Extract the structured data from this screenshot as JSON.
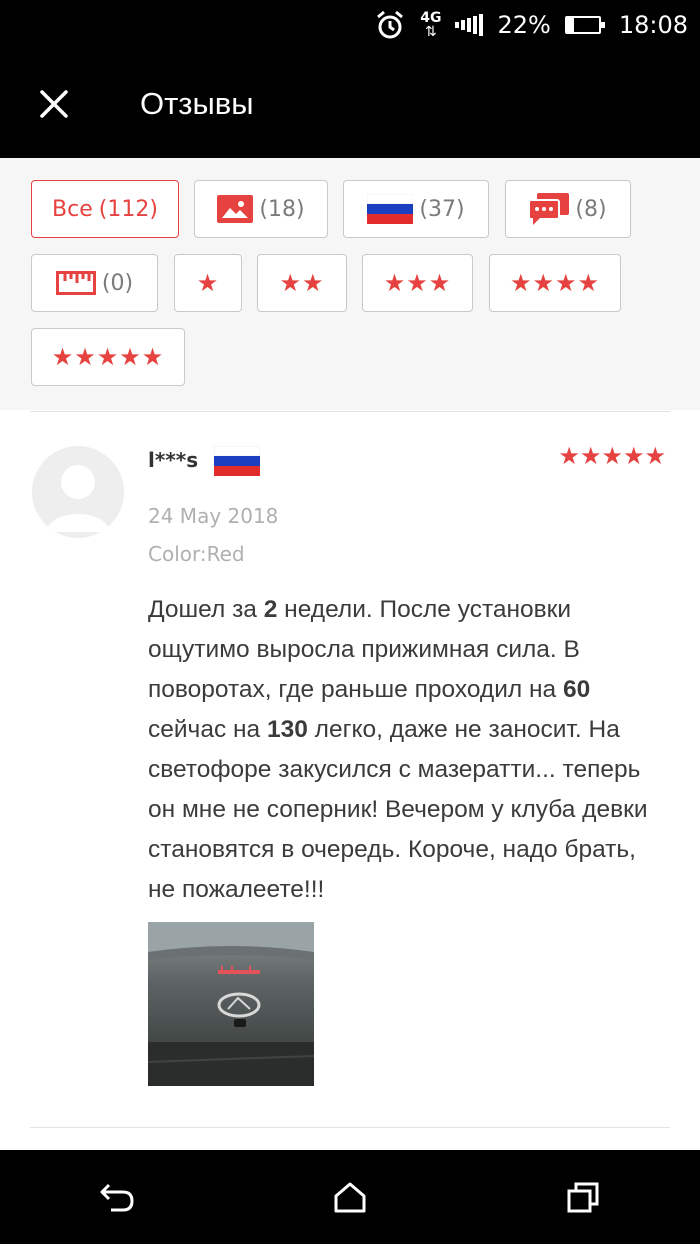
{
  "status_bar": {
    "network": "4G",
    "battery": "22%",
    "battery_level": 0.22,
    "time": "18:08"
  },
  "app_bar": {
    "title": "Отзывы",
    "close_icon": "close-icon"
  },
  "filters": {
    "all_label": "Все",
    "all_count": "(112)",
    "photo_count": "(18)",
    "flag_count": "(37)",
    "comment_count": "(8)",
    "size_count": "(0)",
    "star1": "★",
    "star2": "★★",
    "star3": "★★★",
    "star4": "★★★★",
    "star5": "★★★★★",
    "accent_color": "#e64340"
  },
  "review": {
    "reviewer": "l***s",
    "rating": "★★★★★",
    "date": "24 May 2018",
    "color": "Color:Red",
    "text_parts": {
      "p1": "Дошел за ",
      "n1": "2",
      "p2": " недели. После установки ощутимо выросла прижимная сила. В поворотах, где раньше проходил на ",
      "n2": "60",
      "p3": " сейчас на ",
      "n3": "130",
      "p4": " легко, даже не заносит. На светофоре закусился с мазератти... теперь он мне не соперник! Вечером у клуба девки становятся в очередь. Короче, надо брать, не пожалеете!!!"
    }
  },
  "nav_bar": {
    "back_icon": "back-icon",
    "home_icon": "home-icon",
    "recents_icon": "recents-icon"
  }
}
